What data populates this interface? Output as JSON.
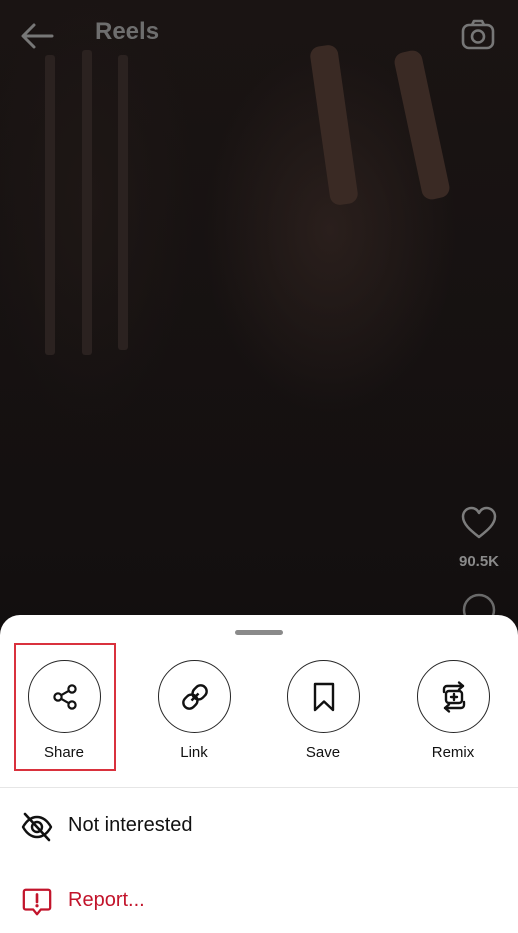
{
  "header": {
    "title": "Reels",
    "back_icon": "arrow-left-icon",
    "camera_icon": "camera-icon"
  },
  "reel": {
    "like_count": "90.5K",
    "like_icon": "heart-icon",
    "comment_icon": "comment-icon"
  },
  "sheet": {
    "actions": [
      {
        "label": "Share",
        "icon": "share-icon",
        "highlighted": true
      },
      {
        "label": "Link",
        "icon": "link-icon"
      },
      {
        "label": "Save",
        "icon": "bookmark-icon"
      },
      {
        "label": "Remix",
        "icon": "remix-icon"
      }
    ],
    "options": [
      {
        "label": "Not interested",
        "icon": "eye-off-icon"
      },
      {
        "label": "Report...",
        "icon": "report-icon"
      }
    ]
  },
  "colors": {
    "highlight_border": "#d9313d",
    "report_red": "#c2142b",
    "sheet_bg": "#ffffff"
  }
}
